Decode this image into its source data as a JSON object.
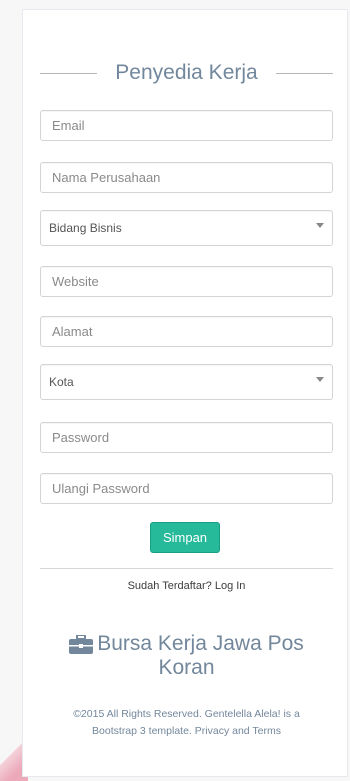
{
  "form": {
    "title": "Penyedia Kerja",
    "email_placeholder": "Email",
    "company_placeholder": "Nama Perusahaan",
    "business_select": "Bidang Bisnis",
    "website_placeholder": "Website",
    "address_placeholder": "Alamat",
    "city_select": "Kota",
    "password_placeholder": "Password",
    "repeat_password_placeholder": "Ulangi Password",
    "submit_label": "Simpan",
    "login_prompt": "Sudah Terdaftar?",
    "login_link": "Log In"
  },
  "brand": {
    "icon": "briefcase-icon",
    "line1": "Bursa Kerja Jawa Pos",
    "line2": "Koran"
  },
  "footer": {
    "line1": "©2015 All Rights Reserved. Gentelella Alela! is a",
    "line2": "Bootstrap 3 template. Privacy and Terms"
  },
  "colors": {
    "accent": "#26b99a",
    "title": "#73879c",
    "background": "#f7f7f7"
  }
}
